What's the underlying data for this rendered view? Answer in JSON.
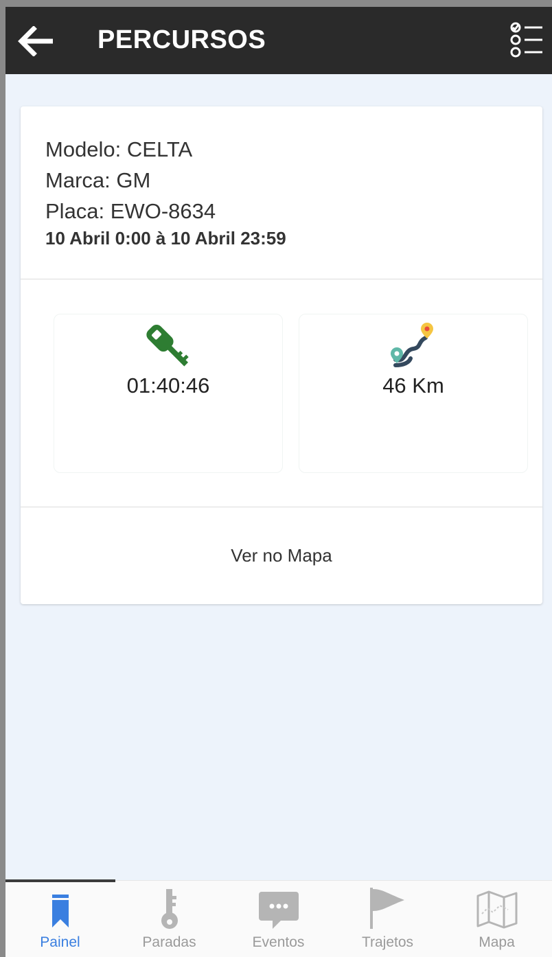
{
  "header": {
    "title": "PERCURSOS",
    "back_icon": "arrow-left-icon",
    "menu_icon": "checklist-icon"
  },
  "vehicle": {
    "modelo": "Modelo: CELTA",
    "marca": "Marca: GM",
    "placa": "Placa: EWO-8634",
    "period": "10 Abril 0:00 à 10 Abril 23:59"
  },
  "stats": [
    {
      "icon": "car-key-icon",
      "value": "01:40:46"
    },
    {
      "icon": "route-icon",
      "value": "46 Km"
    }
  ],
  "map_link": "Ver no Mapa",
  "bottom_nav": [
    {
      "label": "Painel",
      "icon": "bookmark-icon",
      "active": true
    },
    {
      "label": "Paradas",
      "icon": "key-icon",
      "active": false
    },
    {
      "label": "Eventos",
      "icon": "chat-icon",
      "active": false
    },
    {
      "label": "Trajetos",
      "icon": "flag-icon",
      "active": false
    },
    {
      "label": "Mapa",
      "icon": "map-icon",
      "active": false
    }
  ],
  "colors": {
    "appbar": "#2a2a2a",
    "background": "#edf3fb",
    "active_nav": "#3a7fe0",
    "key_green": "#2e7d32"
  }
}
